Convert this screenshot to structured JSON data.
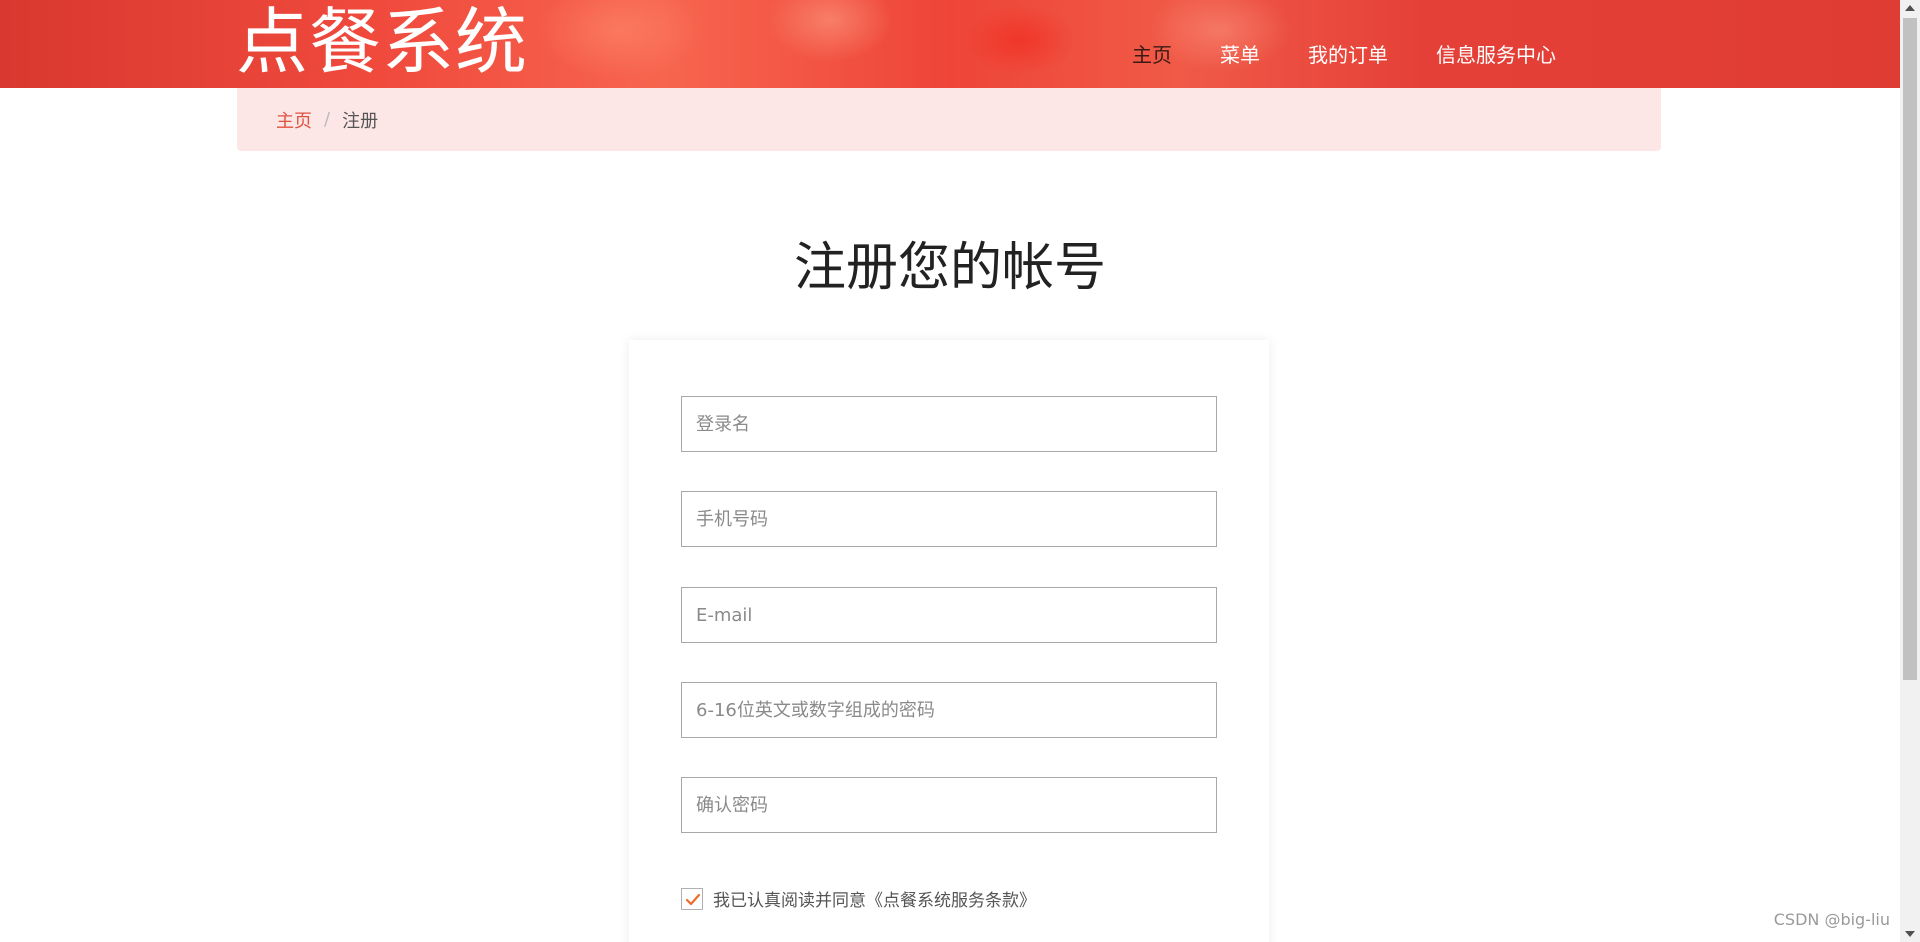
{
  "header": {
    "logo": "点餐系统",
    "nav": [
      {
        "label": "主页",
        "active": true
      },
      {
        "label": "菜单",
        "active": false
      },
      {
        "label": "我的订单",
        "active": false
      },
      {
        "label": "信息服务中心",
        "active": false
      }
    ]
  },
  "breadcrumb": {
    "home": "主页",
    "separator": "/",
    "current": "注册"
  },
  "main": {
    "title": "注册您的帐号",
    "form": {
      "username_placeholder": "登录名",
      "phone_placeholder": "手机号码",
      "email_placeholder": "E-mail",
      "password_placeholder": "6-16位英文或数字组成的密码",
      "confirm_placeholder": "确认密码",
      "agreement_checked": true,
      "agreement_text": "我已认真阅读并同意《点餐系统服务条款》"
    }
  },
  "watermark": "CSDN @big-liu",
  "colors": {
    "header_red": "#e8463b",
    "breadcrumb_bg": "#fde7e6",
    "link_red": "#e05240",
    "check_orange": "#f06a2a"
  }
}
